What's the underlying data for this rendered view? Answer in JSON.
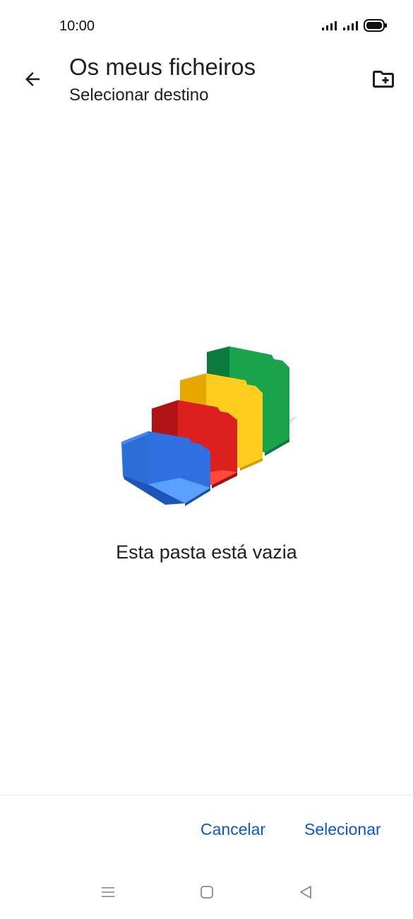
{
  "status_bar": {
    "time": "10:00",
    "icons": [
      "signal-icon",
      "signal-icon",
      "battery-icon"
    ]
  },
  "app_bar": {
    "back_icon": "arrow-back-icon",
    "title": "Os meus ficheiros",
    "subtitle": "Selecionar destino",
    "new_folder_icon": "create-new-folder-icon"
  },
  "empty_state": {
    "illustration": "empty-folders-illustration",
    "message": "Esta pasta está vazia",
    "colors": {
      "blue": "#4285f4",
      "red": "#db3236",
      "yellow": "#fbc02d",
      "green": "#0f9d58"
    }
  },
  "dialog_actions": {
    "cancel_label": "Cancelar",
    "select_label": "Selecionar",
    "accent_color": "#0b57d0"
  },
  "nav_bar": {
    "items": [
      "menu-icon",
      "home-icon",
      "back-triangle-icon"
    ]
  }
}
